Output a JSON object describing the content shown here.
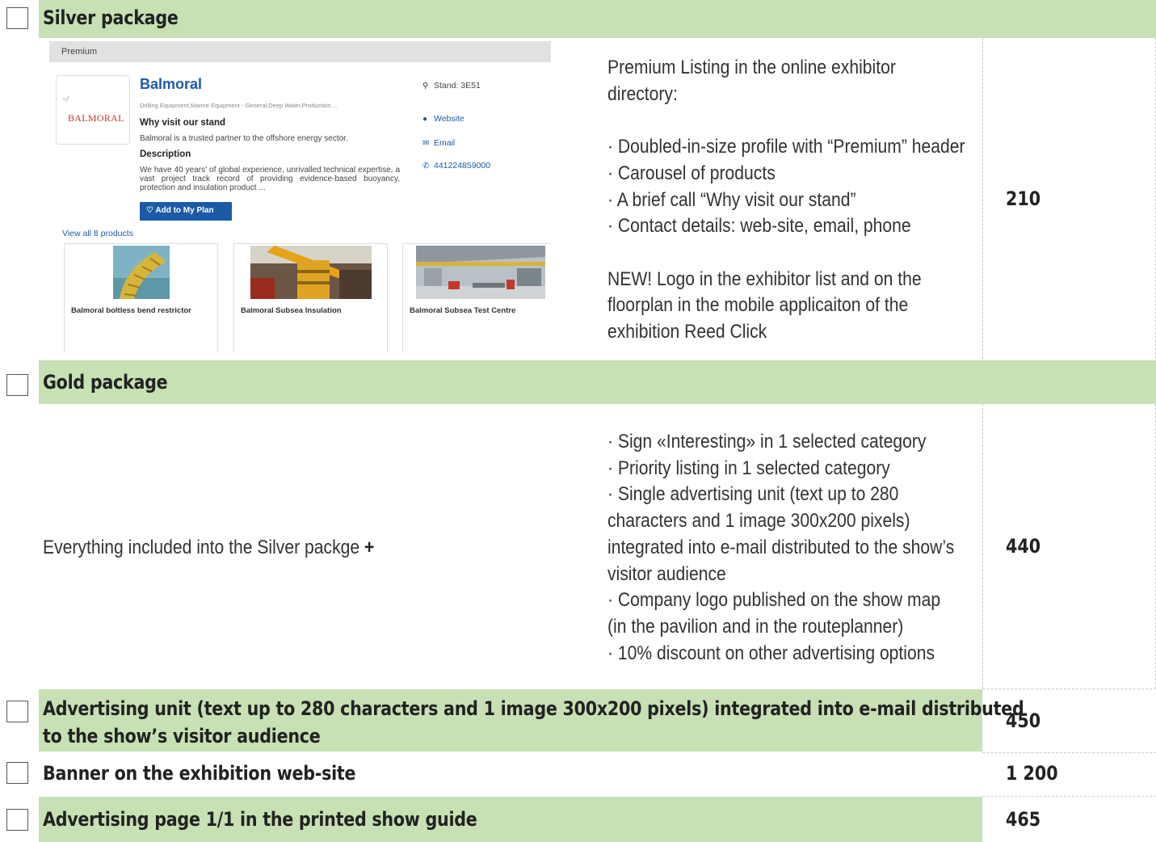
{
  "silver": {
    "title": "Silver package",
    "price": "210",
    "description": [
      "Premium Listing in the online exhibitor",
      "directory:",
      "",
      "· Doubled-in-size profile with “Premium” header",
      "· Carousel of products",
      "· A brief call “Why visit our stand”",
      "· Contact details: web-site, email, phone",
      "",
      "NEW! Logo in the exhibitor list and on the",
      "floorplan in the mobile applicaiton of the",
      "exhibition Reed Click"
    ],
    "preview": {
      "header": "Premium",
      "logo_text": "BALMORAL",
      "company": "Balmoral",
      "categories": "Drilling Equipment,Marine Equipment - General,Deep Water,Production ...",
      "why_heading": "Why visit our stand",
      "why_text": "Balmoral is a trusted partner to the offshore energy sector.",
      "desc_heading": "Description",
      "desc_text": "We have 40 years' of global experience, unrivalled technical expertise, a vast project track record of providing evidence-based buoyancy, protection and insulation product ...",
      "add_button": "Add to My Plan",
      "stand": "Stand: 3E51",
      "website": "Website",
      "email": "Email",
      "phone": "441224859000",
      "view_all": "View all 8 products",
      "products": [
        "Balmoral boltless bend restrictor",
        "Balmoral Subsea Insulation",
        "Balmoral Subsea Test Centre"
      ]
    }
  },
  "gold": {
    "title": "Gold package",
    "price": "440",
    "intro": "Everything included into the Silver packge",
    "plus": "+",
    "description": [
      "· Sign «Interesting» in 1 selected category",
      "· Priority listing in 1 selected category",
      "·  Single advertising unit (text up to 280",
      "characters and 1 image 300x200 pixels)",
      "integrated into e-mail distributed to the show’s",
      "visitor audience",
      "· Company logo published on the show map",
      "(in the pavilion and in the routeplanner)",
      "· 10% discount on other advertising options"
    ]
  },
  "advertising_unit": {
    "title_line1": "Advertising unit (text up to 280 characters and 1 image 300x200 pixels) integrated into e-mail distributed",
    "title_line2": "to the show’s visitor audience",
    "price": "450"
  },
  "banner": {
    "title": "Banner on the exhibition web-site",
    "price": "1 200"
  },
  "advertising_page": {
    "title": "Advertising page 1/1 in the printed show guide",
    "price": "465"
  },
  "colors": {
    "band": "#c7e0b4",
    "link_blue": "#1c5aa8"
  }
}
